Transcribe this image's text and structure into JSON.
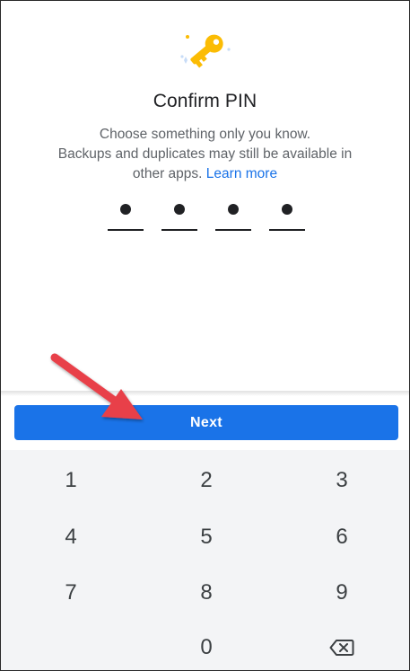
{
  "screen": {
    "title": "Confirm PIN",
    "subtitle_line1": "Choose something only you know.",
    "subtitle_line2": "Backups and duplicates may still be available in",
    "subtitle_line3": "other apps.",
    "learn_more": "Learn more",
    "icon": "key-icon"
  },
  "pin": {
    "length": 4,
    "entered": 4
  },
  "next_button": {
    "label": "Next"
  },
  "keypad": {
    "keys": [
      "1",
      "2",
      "3",
      "4",
      "5",
      "6",
      "7",
      "8",
      "9",
      "",
      "0",
      "backspace-icon"
    ]
  },
  "colors": {
    "accent": "#1a73e8",
    "key_icon": "#fbbc04",
    "arrow": "#e8414a",
    "keypad_bg": "#f3f4f6"
  }
}
